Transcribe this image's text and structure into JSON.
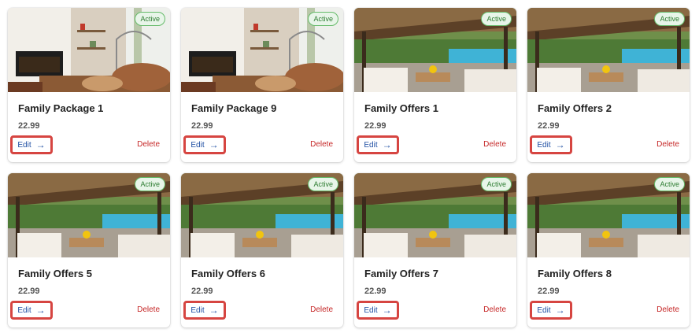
{
  "cards": [
    {
      "title": "Family Package 1",
      "price": "22.99",
      "status": "Active",
      "edit_label": "Edit",
      "delete_label": "Delete",
      "image": "living-room"
    },
    {
      "title": "Family Package 9",
      "price": "22.99",
      "status": "Active",
      "edit_label": "Edit",
      "delete_label": "Delete",
      "image": "living-room"
    },
    {
      "title": "Family Offers 1",
      "price": "22.99",
      "status": "Active",
      "edit_label": "Edit",
      "delete_label": "Delete",
      "image": "pool-cabana"
    },
    {
      "title": "Family Offers 2",
      "price": "22.99",
      "status": "Active",
      "edit_label": "Edit",
      "delete_label": "Delete",
      "image": "pool-cabana"
    },
    {
      "title": "Family Offers 5",
      "price": "22.99",
      "status": "Active",
      "edit_label": "Edit",
      "delete_label": "Delete",
      "image": "pool-cabana"
    },
    {
      "title": "Family Offers 6",
      "price": "22.99",
      "status": "Active",
      "edit_label": "Edit",
      "delete_label": "Delete",
      "image": "pool-cabana"
    },
    {
      "title": "Family Offers 7",
      "price": "22.99",
      "status": "Active",
      "edit_label": "Edit",
      "delete_label": "Delete",
      "image": "pool-cabana"
    },
    {
      "title": "Family Offers 8",
      "price": "22.99",
      "status": "Active",
      "edit_label": "Edit",
      "delete_label": "Delete",
      "image": "pool-cabana"
    }
  ],
  "icons": {
    "edit": "arrow-right-icon"
  },
  "colors": {
    "accent": "#1f4fa3",
    "danger": "#c62828",
    "badge_green": "#2e7d32",
    "highlight": "#d64541"
  }
}
